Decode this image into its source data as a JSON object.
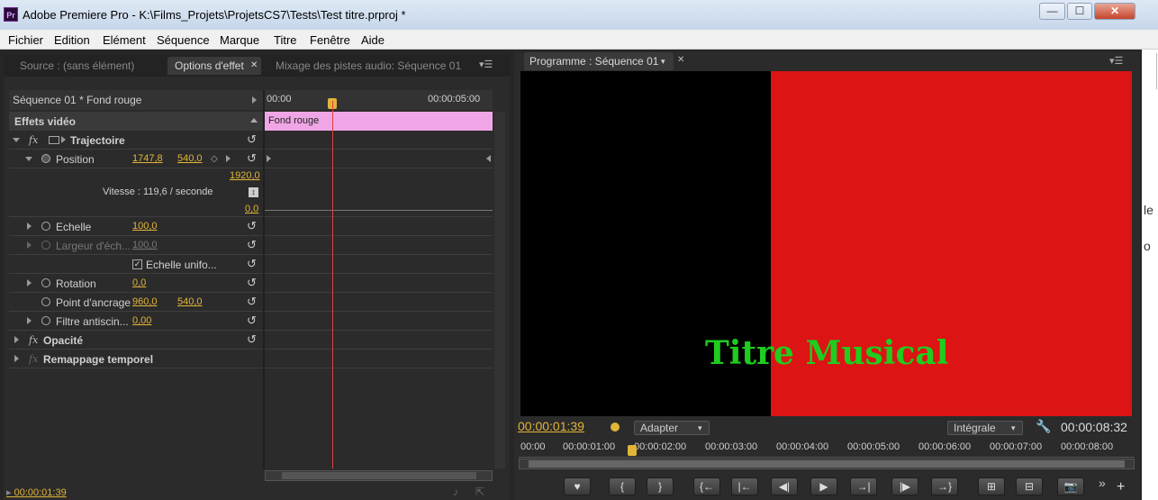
{
  "window": {
    "app_icon": "Pr",
    "title": "Adobe Premiere Pro - K:\\Films_Projets\\ProjetsCS7\\Tests\\Test titre.prproj *",
    "minimize": "—",
    "maximize": "☐",
    "close": "✕"
  },
  "menu": [
    "Fichier",
    "Edition",
    "Elément",
    "Séquence",
    "Marque",
    "Titre",
    "Fenêtre",
    "Aide"
  ],
  "left_panel": {
    "tabs": {
      "source": "Source : (sans élément)",
      "effect_controls": "Options d'effet",
      "effect_close": "✕",
      "audio_mixer": "Mixage des pistes audio: Séquence 01"
    },
    "clip_header": "Séquence 01 * Fond rouge",
    "timeline_start": "00:00",
    "timeline_end": "00:00:05:00",
    "clip_bar": "Fond rouge",
    "section": "Effets vidéo",
    "motion": "Trajectoire",
    "position_label": "Position",
    "position_x": "1747,8",
    "position_y": "540,0",
    "graph_max": "1920,0",
    "speed_label": "Vitesse : 119,6 / seconde",
    "graph_min": "0,0",
    "scale_label": "Echelle",
    "scale_value": "100,0",
    "width_label": "Largeur d'éch...",
    "width_value": "100,0",
    "uniform_label": "Echelle unifo...",
    "rotation_label": "Rotation",
    "rotation_value": "0,0",
    "anchor_label": "Point d'ancrage",
    "anchor_x": "960,0",
    "anchor_y": "540,0",
    "flicker_label": "Filtre antiscin...",
    "flicker_value": "0,00",
    "opacity": "Opacité",
    "time_remap": "Remappage temporel",
    "fx": "fx",
    "timecode": "00:00:01:39"
  },
  "program_panel": {
    "tab": "Programme : Séquence 01",
    "tab_close": "✕",
    "title_text": "Titre Musical",
    "current_time": "00:00:01:39",
    "fit": "Adapter",
    "quality": "Intégrale",
    "duration": "00:00:08:32",
    "ruler": [
      "00:00",
      "00:00:01:00",
      "00:00:02:00",
      "00:00:03:00",
      "00:00:04:00",
      "00:00:05:00",
      "00:00:06:00",
      "00:00:07:00",
      "00:00:08:00"
    ],
    "playhead_fraction": 0.183,
    "controls": [
      "♥",
      "{",
      "}",
      "{←",
      "|←",
      "◀|",
      "▶",
      "→|",
      "|▶",
      "→}",
      "⊞",
      "⊟",
      "📷"
    ],
    "more": "»",
    "add": "+"
  },
  "colors": {
    "red_bg": "#dc1414",
    "title_green": "#1fcc1f",
    "timecode_yellow": "#e2b537",
    "clip_pink": "#f0a6e6"
  },
  "right_strip": [
    "le",
    "o"
  ]
}
